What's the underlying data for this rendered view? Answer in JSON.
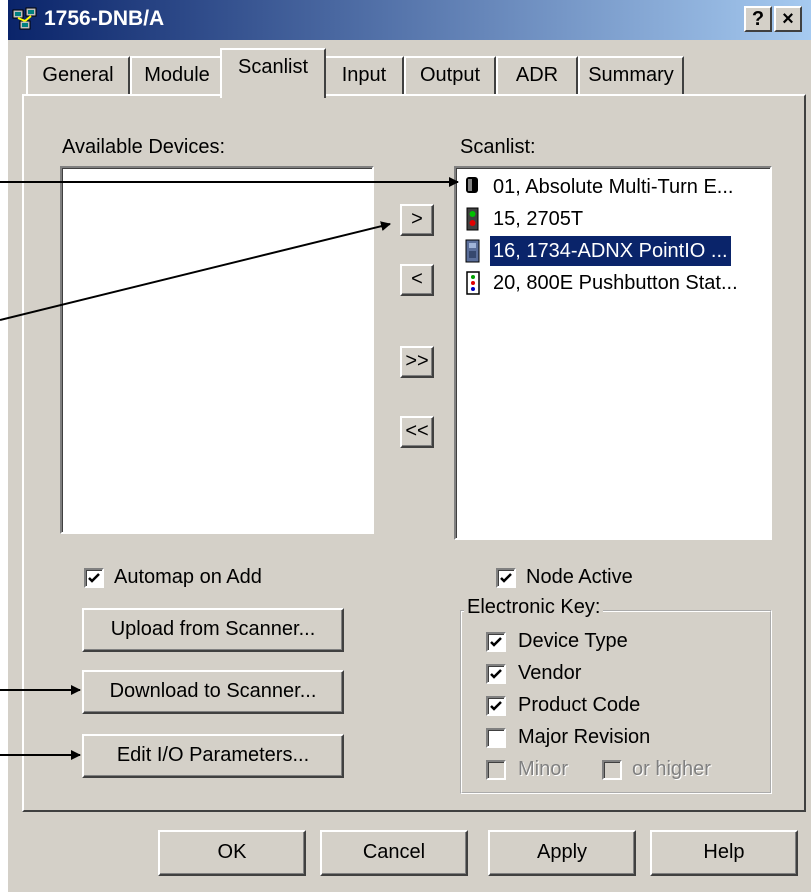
{
  "window": {
    "title": "1756-DNB/A",
    "help_button": "?",
    "close_button": "×"
  },
  "tabs": [
    "General",
    "Module",
    "Scanlist",
    "Input",
    "Output",
    "ADR",
    "Summary"
  ],
  "active_tab": "Scanlist",
  "available": {
    "label": "Available Devices:",
    "items": []
  },
  "scanlist": {
    "label": "Scanlist:",
    "items": [
      {
        "text": "01, Absolute Multi-Turn E...",
        "icon": "encoder-icon",
        "selected": false
      },
      {
        "text": "15, 2705T",
        "icon": "stack-light-icon",
        "selected": false
      },
      {
        "text": "16, 1734-ADNX PointIO ...",
        "icon": "pointio-adapter-icon",
        "selected": true
      },
      {
        "text": "20, 800E Pushbutton Stat...",
        "icon": "pushbutton-station-icon",
        "selected": false
      }
    ]
  },
  "transfer_buttons": {
    "add": ">",
    "remove": "<",
    "add_all": ">>",
    "remove_all": "<<"
  },
  "automap": {
    "label": "Automap on Add",
    "checked": true
  },
  "node_active": {
    "label": "Node Active",
    "checked": true
  },
  "buttons": {
    "upload": "Upload from Scanner...",
    "download": "Download to Scanner...",
    "edit_io": "Edit I/O Parameters..."
  },
  "electronic_key": {
    "title": "Electronic Key:",
    "device_type": {
      "label": "Device Type",
      "checked": true
    },
    "vendor": {
      "label": "Vendor",
      "checked": true
    },
    "product_code": {
      "label": "Product Code",
      "checked": true
    },
    "major_revision": {
      "label": "Major Revision",
      "checked": false
    },
    "minor": {
      "label": "Minor",
      "checked": false,
      "enabled": false
    },
    "or_higher": {
      "label": "or higher",
      "checked": false,
      "enabled": false
    }
  },
  "footer": {
    "ok": "OK",
    "cancel": "Cancel",
    "apply": "Apply",
    "help": "Help"
  },
  "colors": {
    "titlebar_start": "#0a246a",
    "titlebar_end": "#a6caf0",
    "face": "#d4d0c8",
    "selection": "#0a246a"
  }
}
